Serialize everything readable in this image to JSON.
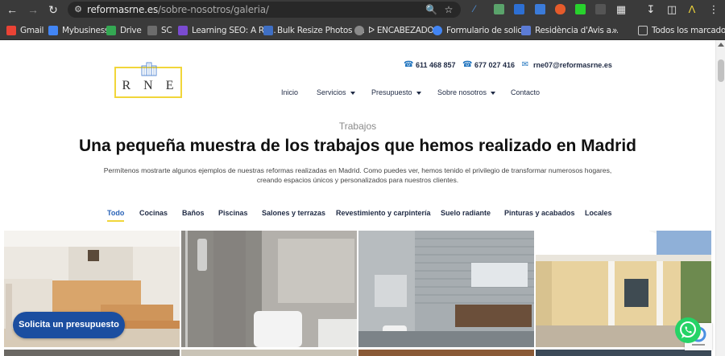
{
  "browser": {
    "url_domain": "reformasrne.es",
    "url_path": "/sobre-nosotros/galeria/",
    "bookmarks": [
      {
        "label": "Gmail",
        "color": "#ea4335"
      },
      {
        "label": "Mybusiness",
        "color": "#4285f4"
      },
      {
        "label": "Drive",
        "color": "#34a853"
      },
      {
        "label": "SC",
        "color": "#6c6c6c"
      },
      {
        "label": "Learning SEO: A Ro...",
        "color": "#7a4bd1"
      },
      {
        "label": "Bulk Resize Photos -...",
        "color": "#3f6fc4"
      },
      {
        "label": "ᐅ ENCABEZADOS",
        "color": "#8a8a8a"
      },
      {
        "label": "Formulario de solici...",
        "color": "#4285f4"
      },
      {
        "label": "Residència d'Avis a...",
        "color": "#5b7bd5"
      },
      {
        "label": "»",
        "color": ""
      },
      {
        "label": "Todos los marcadores",
        "color": "#c6c6c6"
      }
    ]
  },
  "header": {
    "logo_letters": [
      "R",
      "N",
      "E"
    ],
    "phone1": "611 468 857",
    "phone2": "677 027 416",
    "email": "rne07@reformasrne.es",
    "nav": [
      {
        "label": "Inicio",
        "dropdown": false
      },
      {
        "label": "Servicios",
        "dropdown": true
      },
      {
        "label": "Presupuesto",
        "dropdown": true
      },
      {
        "label": "Sobre nosotros",
        "dropdown": true
      },
      {
        "label": "Contacto",
        "dropdown": false
      }
    ]
  },
  "main": {
    "kicker": "Trabajos",
    "title": "Una pequeña muestra de los trabajos que hemos realizado en Madrid",
    "description_line1": "Permítenos mostrarte algunos ejemplos de nuestras reformas realizadas en Madrid. Como puedes ver, hemos tenido el privilegio de transformar numerosos hogares,",
    "description_line2": "creando espacios únicos y personalizados para nuestros clientes.",
    "filters": [
      "Todo",
      "Cocinas",
      "Baños",
      "Piscinas",
      "Salones y terrazas",
      "Revestimiento y carpintería",
      "Suelo radiante",
      "Pinturas y acabados",
      "Locales"
    ],
    "active_filter": "Todo"
  },
  "cta": {
    "label": "Solicita un presupuesto"
  },
  "colors": {
    "accent_blue": "#1b4ea0",
    "logo_yellow": "#f1d63a",
    "whatsapp": "#25d366"
  }
}
